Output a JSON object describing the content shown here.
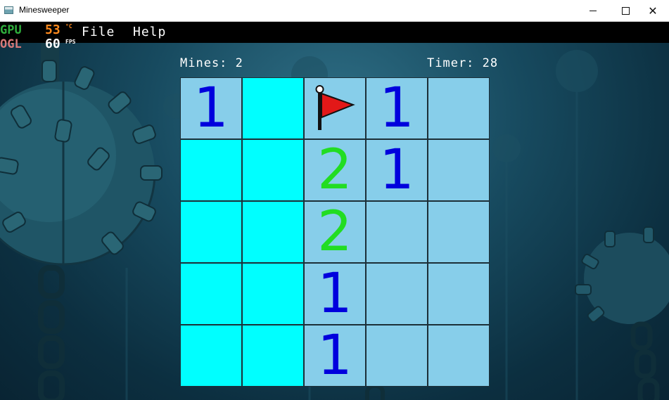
{
  "window": {
    "title": "Minesweeper"
  },
  "menu": {
    "file": "File",
    "help": "Help"
  },
  "overlay": {
    "gpu": "GPU",
    "ogl": "OGL",
    "temp": "53",
    "temp_unit": "°C",
    "fps": "60",
    "fps_unit": "FPS"
  },
  "status": {
    "mines": "Mines: 2",
    "timer": "Timer: 28"
  },
  "colors": {
    "revealed": "#87ceea",
    "hidden": "#00ffff",
    "one": "#0000dd",
    "two": "#22dd22",
    "flag": "#e21818"
  },
  "board": {
    "rows": 5,
    "cols": 5,
    "cells": [
      [
        "1",
        "#",
        "F",
        "1",
        ""
      ],
      [
        "#",
        "#",
        "2",
        "1",
        ""
      ],
      [
        "#",
        "#",
        "2",
        "",
        ""
      ],
      [
        "#",
        "#",
        "1",
        "",
        ""
      ],
      [
        "#",
        "#",
        "1",
        "",
        ""
      ]
    ]
  }
}
